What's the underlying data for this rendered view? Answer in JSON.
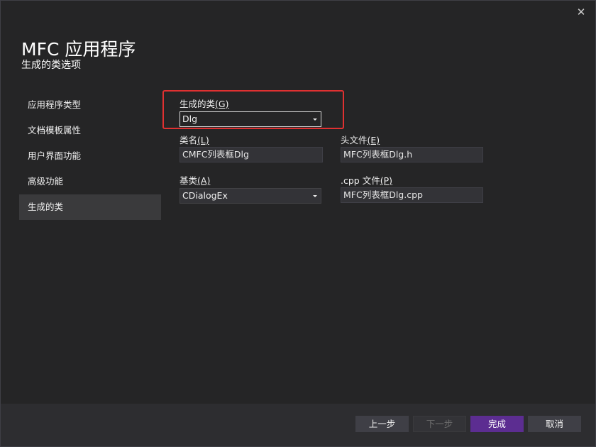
{
  "window": {
    "close_glyph": "✕"
  },
  "header": {
    "title": "MFC 应用程序",
    "subtitle": "生成的类选项"
  },
  "nav": {
    "items": [
      {
        "label": "应用程序类型"
      },
      {
        "label": "文档模板属性"
      },
      {
        "label": "用户界面功能"
      },
      {
        "label": "高级功能"
      },
      {
        "label": "生成的类",
        "selected": true
      }
    ]
  },
  "form": {
    "generated_class": {
      "label": "生成的类",
      "accel": "(G)",
      "value": "Dlg"
    },
    "class_name": {
      "label": "类名",
      "accel": "(L)",
      "value": "CMFC列表框Dlg"
    },
    "header_file": {
      "label": "头文件",
      "accel": "(E)",
      "value": "MFC列表框Dlg.h"
    },
    "base_class": {
      "label": "基类",
      "accel": "(A)",
      "value": "CDialogEx"
    },
    "cpp_file": {
      "label": ".cpp 文件",
      "accel": "(P)",
      "value": "MFC列表框Dlg.cpp"
    }
  },
  "footer": {
    "prev_label": "上一步",
    "next_label": "下一步",
    "finish_label": "完成",
    "cancel_label": "取消"
  },
  "colors": {
    "accent": "#5c2d91",
    "highlight_box": "#e03131",
    "background": "#252526"
  }
}
